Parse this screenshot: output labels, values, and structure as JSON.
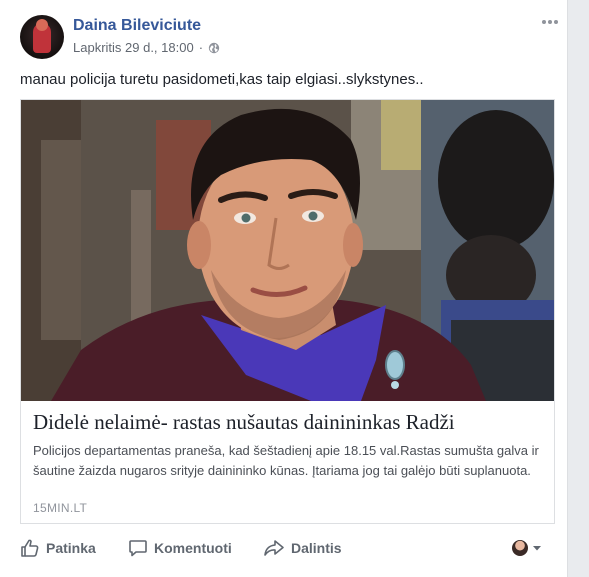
{
  "post": {
    "author_name": "Daina Bileviciute",
    "timestamp": "Lapkritis 29 d., 18:00",
    "separator": "·",
    "privacy_icon": "globe-icon",
    "options_icon": "more-options-icon",
    "text": "manau policija turetu pasidometi,kas taip elgiasi..slykstynes.."
  },
  "link_preview": {
    "image_desc": "portrait-photo",
    "title": "Didelė nelaimė- rastas nušautas dainininkas Radži",
    "description": "Policijos departamentas praneša, kad šeštadienį apie 18.15 val.Rastas sumušta galva ir šautine žaizda nugaros srityje dainininko kūnas. Įtariama jog tai galėjo būti suplanuota.",
    "source": "15MIN.LT"
  },
  "actions": {
    "like_label": "Patinka",
    "comment_label": "Komentuoti",
    "share_label": "Dalintis"
  },
  "colors": {
    "author_link": "#365899",
    "meta_text": "#616770",
    "action_text": "#606770",
    "card_border": "#dddfe2",
    "page_background": "#e9ebee"
  }
}
